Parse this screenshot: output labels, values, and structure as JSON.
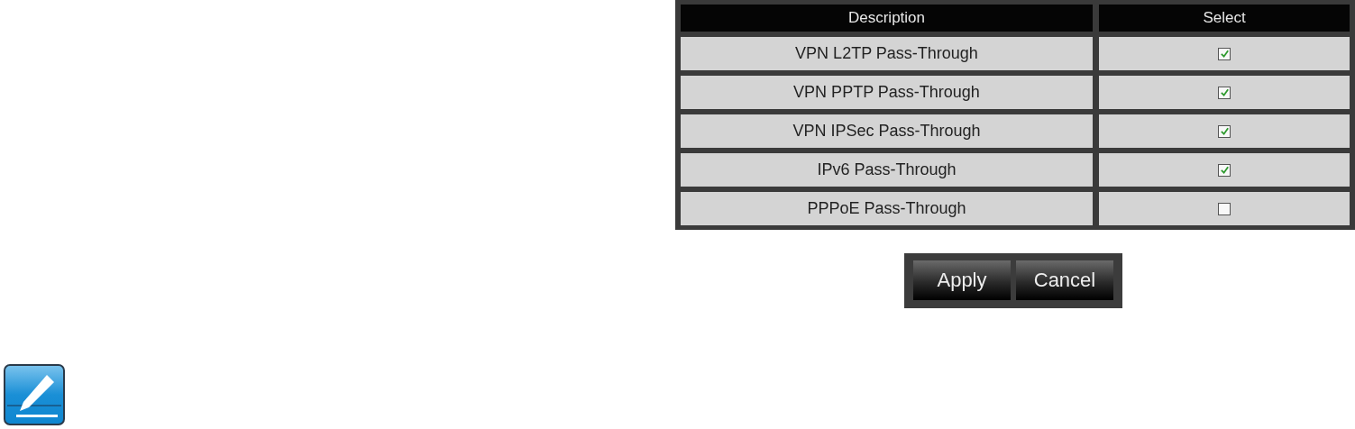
{
  "table": {
    "columns": [
      "Description",
      "Select"
    ],
    "rows": [
      {
        "description": "VPN L2TP Pass-Through",
        "checked": true
      },
      {
        "description": "VPN PPTP Pass-Through",
        "checked": true
      },
      {
        "description": "VPN IPSec Pass-Through",
        "checked": true
      },
      {
        "description": "IPv6 Pass-Through",
        "checked": true
      },
      {
        "description": "PPPoE Pass-Through",
        "checked": false
      }
    ]
  },
  "buttons": [
    "Apply",
    "Cancel"
  ]
}
